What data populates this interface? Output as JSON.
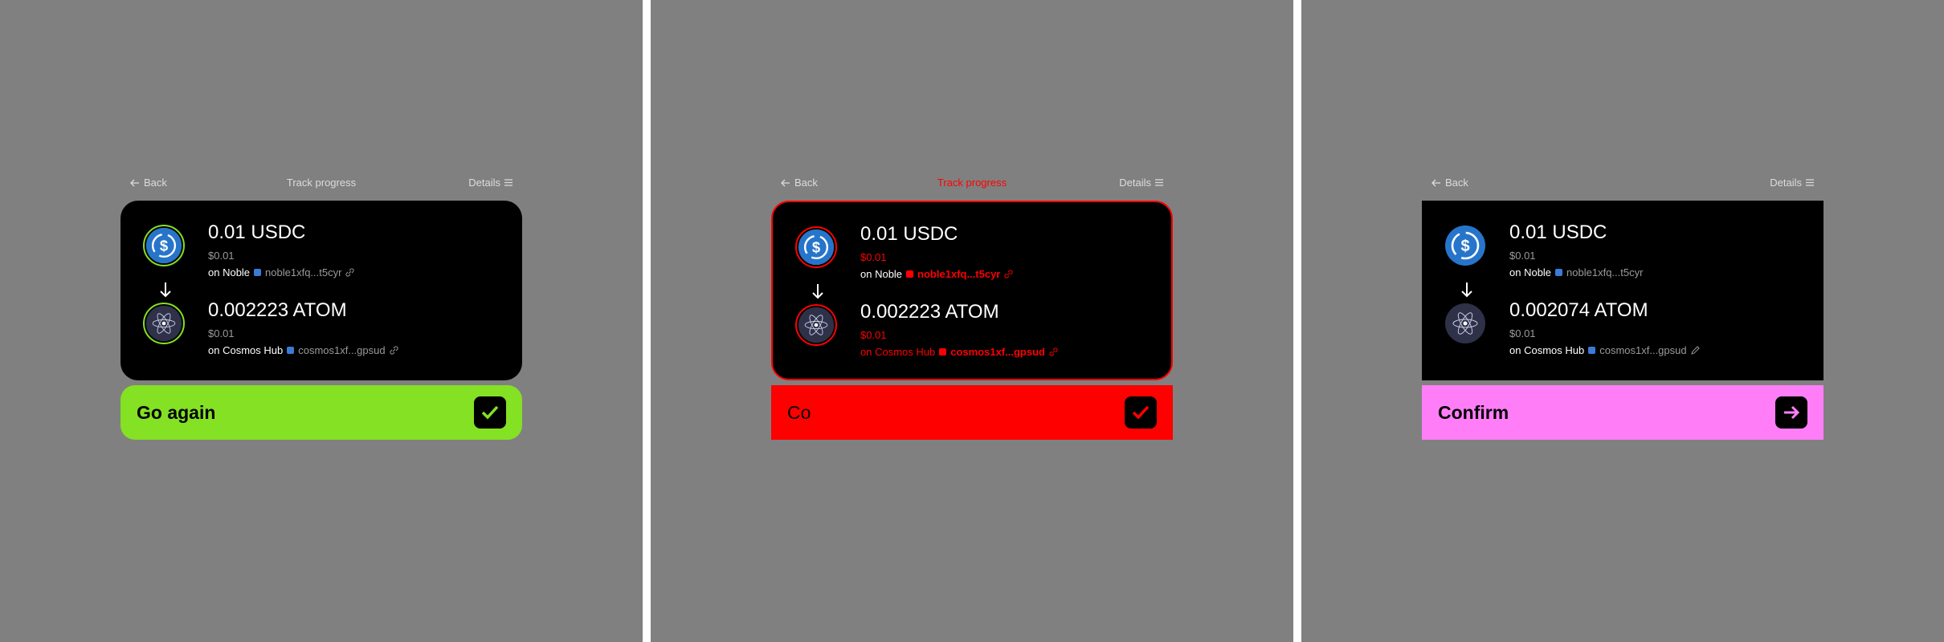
{
  "colors": {
    "panel_bg": "#808080",
    "card_bg": "#000000",
    "success_green": "#84e123",
    "error_red": "#ff0000",
    "confirm_pink": "#ff7ef7",
    "usdc_blue": "#2775ca",
    "atom_dark": "#2e3148"
  },
  "icons": {
    "back": "arrow-left-icon",
    "details": "menu-lines-icon",
    "usdc": "usdc-coin-icon",
    "atom": "atom-coin-icon",
    "down": "arrow-down-icon",
    "external": "link-icon",
    "check": "check-icon",
    "next": "arrow-right-icon"
  },
  "panels": [
    {
      "nav": {
        "back": "Back",
        "title": "Track progress",
        "details": "Details"
      },
      "from": {
        "amount": "0.01 USDC",
        "fiat": "$0.01",
        "chain_prefix": "on Noble",
        "address": "noble1xfq...t5cyr"
      },
      "to": {
        "amount": "0.002223 ATOM",
        "fiat": "$0.01",
        "chain_prefix": "on Cosmos Hub",
        "address": "cosmos1xf...gpsud"
      },
      "cta": {
        "label": "Go again"
      }
    },
    {
      "nav": {
        "back": "Back",
        "title": "Track progress",
        "details": "Details"
      },
      "from": {
        "amount": "0.01 USDC",
        "fiat": "$0.01",
        "chain_prefix": "on Noble",
        "address": "noble1xfq...t5cyr"
      },
      "to": {
        "amount": "0.002223 ATOM",
        "fiat": "$0.01",
        "chain_prefix": "on Cosmos Hub",
        "address": "cosmos1xf...gpsud"
      },
      "cta": {
        "label": "Co"
      }
    },
    {
      "nav": {
        "back": "Back",
        "title": "",
        "details": "Details"
      },
      "from": {
        "amount": "0.01 USDC",
        "fiat": "$0.01",
        "chain_prefix": "on Noble",
        "address": "noble1xfq...t5cyr"
      },
      "to": {
        "amount": "0.002074 ATOM",
        "fiat": "$0.01",
        "chain_prefix": "on Cosmos Hub",
        "address": "cosmos1xf...gpsud"
      },
      "cta": {
        "label": "Confirm"
      }
    }
  ]
}
